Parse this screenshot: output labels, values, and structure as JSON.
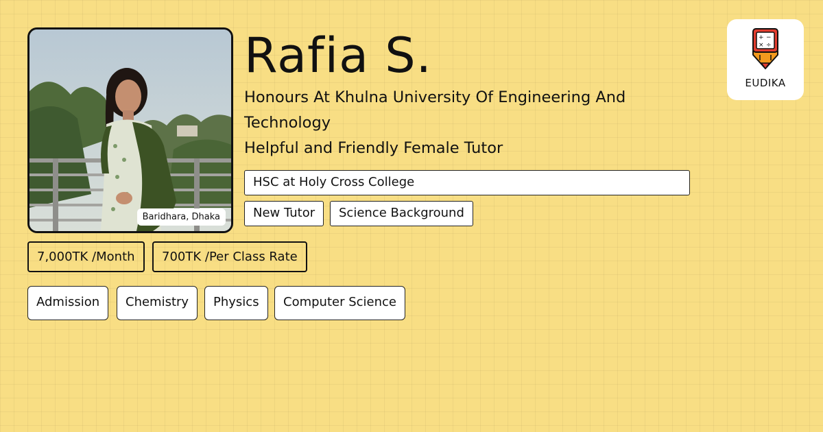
{
  "tutor": {
    "name": "Rafia S.",
    "subtitle_line1": "Honours At Khulna University Of Engineering And Technology",
    "subtitle_line2": "Helpful and Friendly Female Tutor",
    "location": "Baridhara, Dhaka",
    "education": "HSC at Holy Cross College",
    "tags": [
      "New Tutor",
      "Science Background"
    ]
  },
  "rates": {
    "monthly": "7,000TK /Month",
    "per_class": "700TK /Per Class Rate"
  },
  "subjects": [
    "Admission",
    "Chemistry",
    "Physics",
    "Computer Science"
  ],
  "brand": {
    "name": "EUDIKA",
    "icon": "pencil-calculator-icon"
  },
  "colors": {
    "background": "#f8de84",
    "accent_orange": "#f39a1e",
    "accent_red": "#e23d2f"
  }
}
